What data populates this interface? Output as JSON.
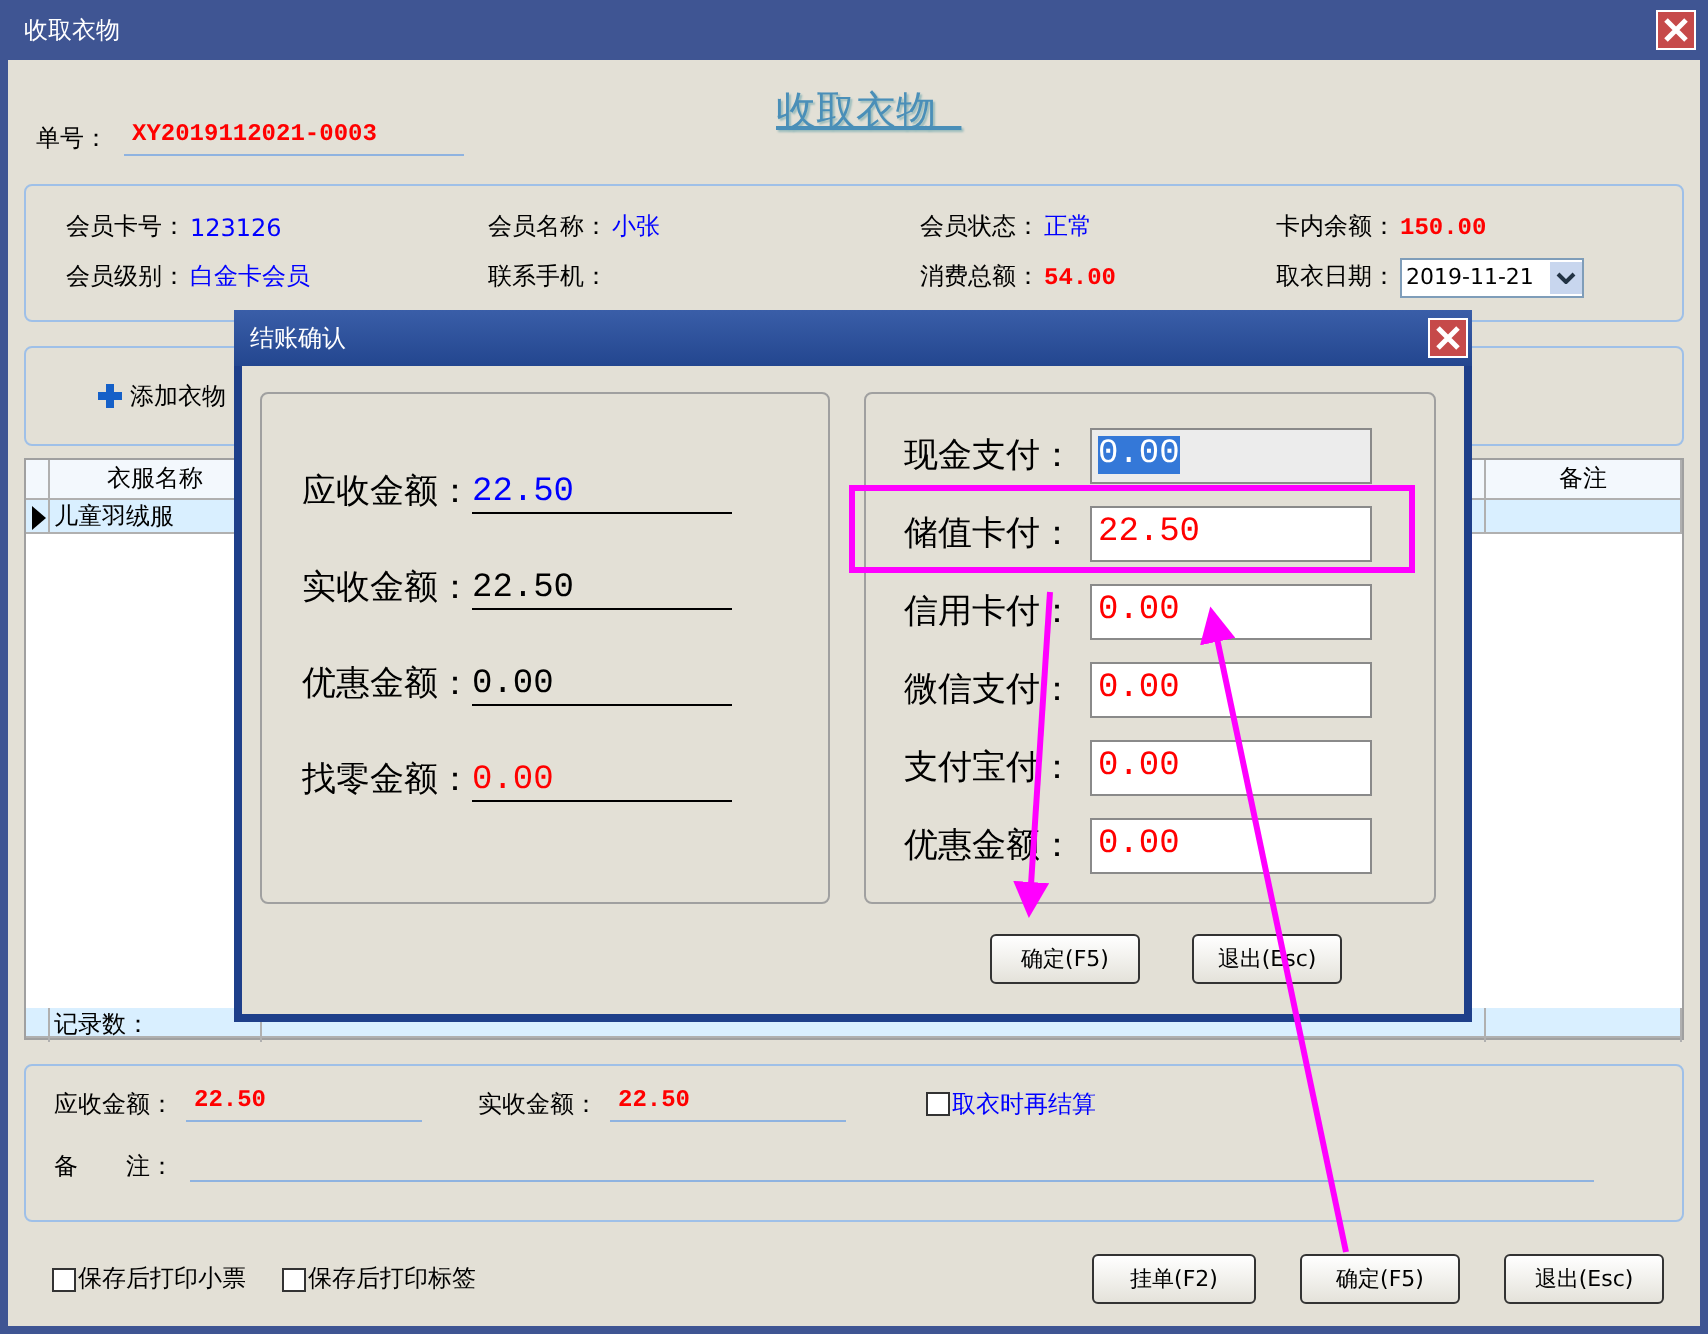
{
  "window": {
    "title": "收取衣物",
    "heading": "收取衣物"
  },
  "order": {
    "label": "单号：",
    "value": "XY2019112021-0003"
  },
  "member": [
    {
      "label": "会员卡号：",
      "value": "123126",
      "color": "#0000ff"
    },
    {
      "label": "会员名称：",
      "value": "小张",
      "color": "#0000ff"
    },
    {
      "label": "会员状态：",
      "value": "正常",
      "color": "#0000ff"
    },
    {
      "label": "卡内余额：",
      "value": "150.00",
      "color": "#ff0000"
    },
    {
      "label": "会员级别：",
      "value": "白金卡会员",
      "color": "#0000ff"
    },
    {
      "label": "联系手机："
    },
    {
      "label": "消费总额：",
      "value": "54.00",
      "color": "#ff0000"
    },
    {
      "label": "取衣日期：",
      "value": "2019-11-21",
      "kind": "date"
    }
  ],
  "toolbar": {
    "add_button": "添加衣物"
  },
  "table": {
    "columns": [
      "衣服名称",
      "备注"
    ],
    "rows": [
      {
        "name": "儿童羽绒服",
        "selected": true
      }
    ],
    "footer": "记录数："
  },
  "totals": [
    {
      "label": "应收金额：",
      "value": "22.50"
    },
    {
      "label": "实收金额：",
      "value": "22.50"
    }
  ],
  "settle_later": {
    "label": "取衣时再结算",
    "checked": false
  },
  "note": {
    "label": "备　　注："
  },
  "options": [
    {
      "label": "保存后打印小票",
      "checked": false
    },
    {
      "label": "保存后打印标签",
      "checked": false
    }
  ],
  "buttons": [
    "挂单(F2)",
    "确定(F5)",
    "退出(Esc)"
  ],
  "dialog": {
    "title": "结账确认",
    "summary": [
      {
        "label": "应收金额：",
        "value": "22.50",
        "color": "#0000ff"
      },
      {
        "label": "实收金额：",
        "value": "22.50",
        "color": "#000000"
      },
      {
        "label": "优惠金额：",
        "value": "0.00",
        "color": "#000000"
      },
      {
        "label": "找零金额：",
        "value": "0.00",
        "color": "#ff0000"
      }
    ],
    "payments": [
      {
        "label": "现金支付：",
        "value": "0.00",
        "selected": true,
        "annotated": false
      },
      {
        "label": "储值卡付：",
        "value": "22.50",
        "selected": false,
        "annotated": true
      },
      {
        "label": "信用卡付：",
        "value": "0.00",
        "selected": false,
        "annotated": false
      },
      {
        "label": "微信支付：",
        "value": "0.00",
        "selected": false,
        "annotated": false
      },
      {
        "label": "支付宝付：",
        "value": "0.00",
        "selected": false,
        "annotated": false
      },
      {
        "label": "优惠金额：",
        "value": "0.00",
        "selected": false,
        "annotated": false
      }
    ],
    "buttons": [
      "确定(F5)",
      "退出(Esc)"
    ]
  }
}
